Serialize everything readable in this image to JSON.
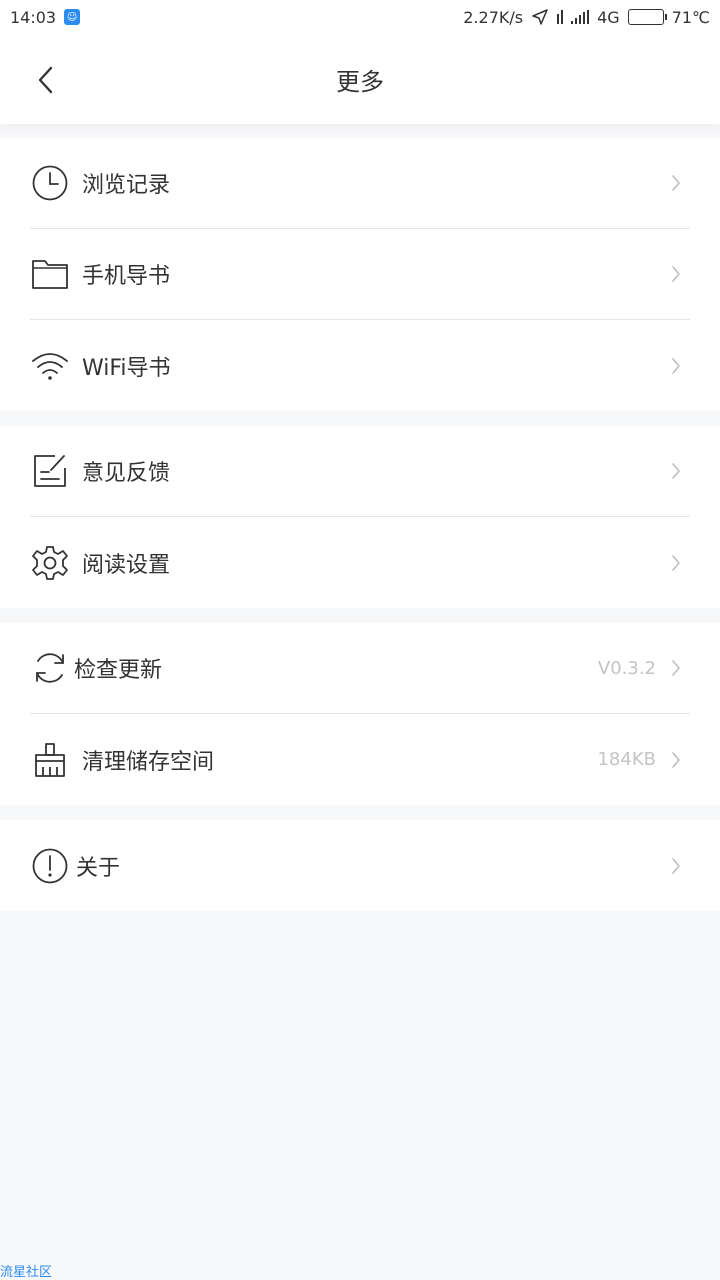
{
  "status_bar": {
    "time": "14:03",
    "net_speed": "2.27K/s",
    "network": "4G",
    "temperature": "71℃"
  },
  "header": {
    "title": "更多"
  },
  "groups": [
    {
      "items": [
        {
          "label": "浏览记录",
          "icon": "clock-icon"
        },
        {
          "label": "手机导书",
          "icon": "folder-icon"
        },
        {
          "label": "WiFi导书",
          "icon": "wifi-icon"
        }
      ]
    },
    {
      "items": [
        {
          "label": "意见反馈",
          "icon": "feedback-icon"
        },
        {
          "label": "阅读设置",
          "icon": "gear-icon"
        }
      ]
    },
    {
      "items": [
        {
          "label": "检查更新",
          "icon": "refresh-icon",
          "value": "V0.3.2"
        },
        {
          "label": "清理储存空间",
          "icon": "broom-icon",
          "value": "184KB"
        }
      ]
    },
    {
      "items": [
        {
          "label": "关于",
          "icon": "info-icon"
        }
      ]
    }
  ],
  "watermark": "流星社区"
}
